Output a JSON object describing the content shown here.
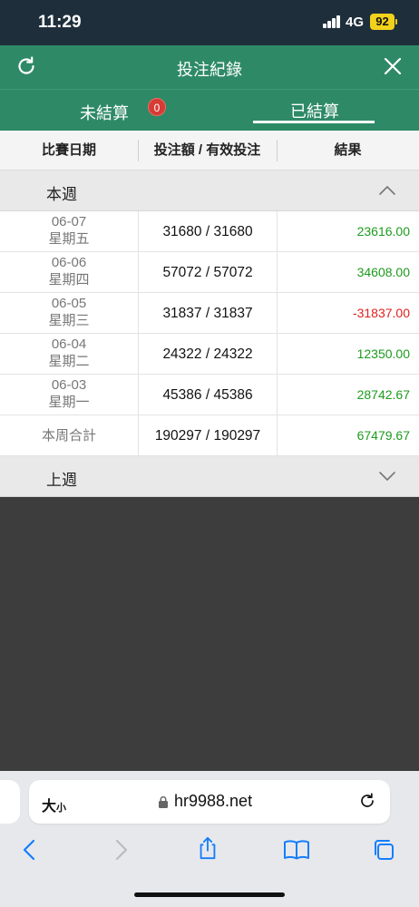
{
  "status_bar": {
    "time": "11:29",
    "network": "4G",
    "battery": "92"
  },
  "header": {
    "title": "投注紀錄"
  },
  "tabs": [
    {
      "label": "未結算",
      "badge": "0"
    },
    {
      "label": "已結算"
    }
  ],
  "table": {
    "headers": [
      "比賽日期",
      "投注額 / 有效投注",
      "結果"
    ],
    "this_week": {
      "label": "本週",
      "rows": [
        {
          "date": "06-07",
          "weekday": "星期五",
          "bet": "31680 / 31680",
          "result": "23616.00"
        },
        {
          "date": "06-06",
          "weekday": "星期四",
          "bet": "57072 / 57072",
          "result": "34608.00"
        },
        {
          "date": "06-05",
          "weekday": "星期三",
          "bet": "31837 / 31837",
          "result": "-31837.00"
        },
        {
          "date": "06-04",
          "weekday": "星期二",
          "bet": "24322 / 24322",
          "result": "12350.00"
        },
        {
          "date": "06-03",
          "weekday": "星期一",
          "bet": "45386 / 45386",
          "result": "28742.67"
        }
      ],
      "total": {
        "label": "本周合計",
        "bet": "190297 / 190297",
        "result": "67479.67"
      }
    },
    "last_week": {
      "label": "上週"
    }
  },
  "browser": {
    "text_size": "大",
    "text_size_small": "小",
    "url": "hr9988.net"
  },
  "colors": {
    "header_green": "#2e8a66",
    "positive": "#1d9b1d",
    "negative": "#e0201e",
    "ios_blue": "#147efb"
  }
}
